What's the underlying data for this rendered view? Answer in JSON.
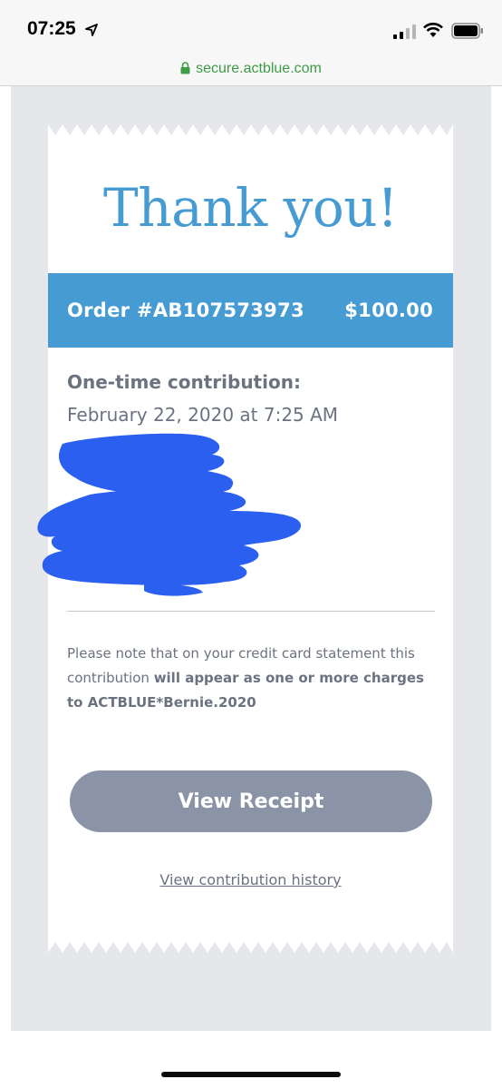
{
  "status_bar": {
    "time": "07:25"
  },
  "browser": {
    "url": "secure.actblue.com"
  },
  "receipt": {
    "heading": "Thank you!",
    "order_label": "Order #AB107573973",
    "amount": "$100.00",
    "contribution_type": "One-time contribution:",
    "contribution_date": "February 22, 2020 at 7:25 AM",
    "note_prefix": "Please note that on your credit card statement this contribution ",
    "note_bold": "will appear as one or more charges to ACTBLUE*Bernie.2020",
    "view_receipt_label": "View Receipt",
    "history_link_label": "View contribution history"
  },
  "colors": {
    "accent_blue": "#479bd3",
    "button_gray": "#8b93a6",
    "text_gray": "#6b7280",
    "redaction_blue": "#2b5ff0",
    "url_green": "#3d9c45"
  }
}
